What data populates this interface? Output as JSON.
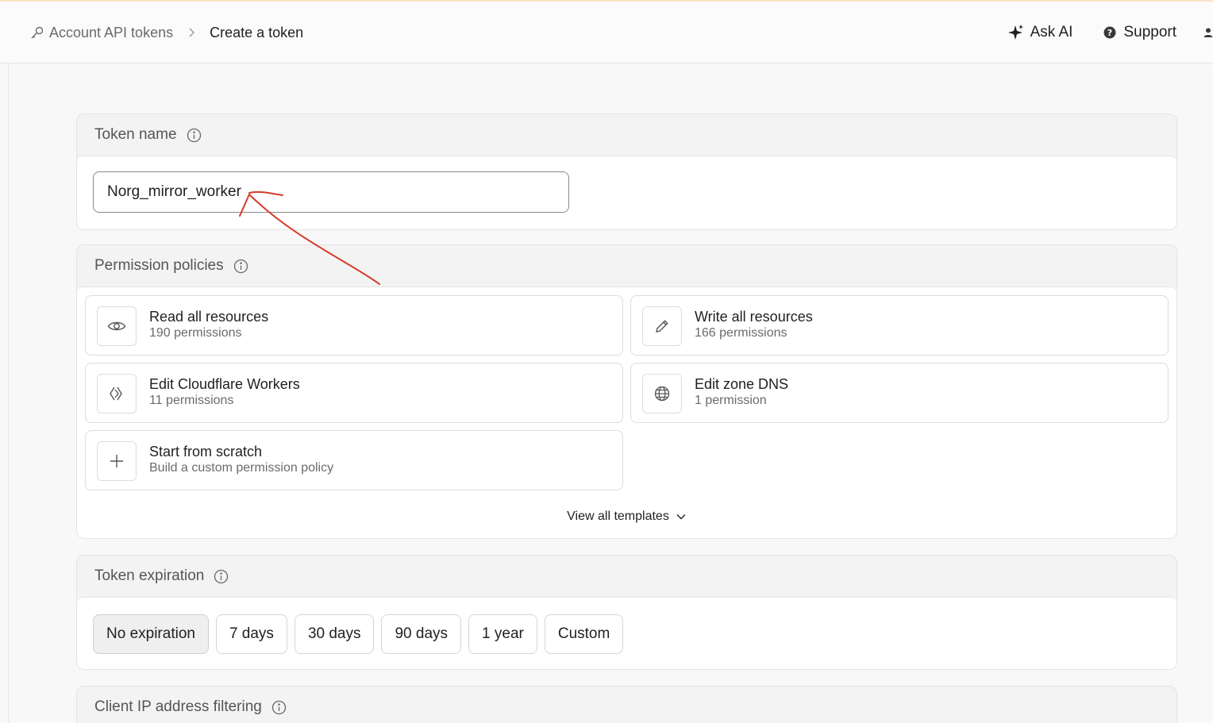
{
  "header": {
    "breadcrumb": {
      "parent": "Account API tokens",
      "current": "Create a token"
    },
    "ask_ai": "Ask AI",
    "support": "Support"
  },
  "token_name": {
    "label": "Token name",
    "value": "Norg_mirror_worker"
  },
  "permissions": {
    "label": "Permission policies",
    "templates": [
      {
        "title": "Read all resources",
        "sub": "190 permissions",
        "icon": "eye-icon"
      },
      {
        "title": "Write all resources",
        "sub": "166 permissions",
        "icon": "pencil-icon"
      },
      {
        "title": "Edit Cloudflare Workers",
        "sub": "11 permissions",
        "icon": "workers-icon"
      },
      {
        "title": "Edit zone DNS",
        "sub": "1 permission",
        "icon": "globe-icon"
      },
      {
        "title": "Start from scratch",
        "sub": "Build a custom permission policy",
        "icon": "plus-icon"
      }
    ],
    "view_all": "View all templates"
  },
  "expiration": {
    "label": "Token expiration",
    "options": [
      "No expiration",
      "7 days",
      "30 days",
      "90 days",
      "1 year",
      "Custom"
    ],
    "selected": "No expiration"
  },
  "ip_filter": {
    "label": "Client IP address filtering"
  },
  "colors": {
    "annotation": "#d63a2a",
    "accent_top": "#fbe1c4"
  }
}
